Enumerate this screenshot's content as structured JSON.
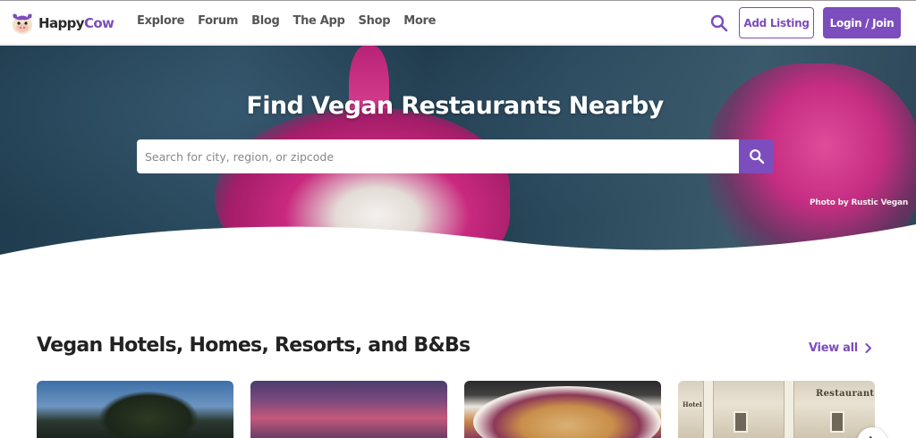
{
  "header": {
    "logo": {
      "happy": "Happy",
      "cow": "Cow"
    },
    "nav": [
      "Explore",
      "Forum",
      "Blog",
      "The App",
      "Shop",
      "More"
    ],
    "add_listing_label": "Add Listing",
    "login_label": "Login / Join"
  },
  "hero": {
    "title": "Find Vegan Restaurants Nearby",
    "search_placeholder": "Search for city, region, or zipcode",
    "photo_credit": "Photo by Rustic Vegan"
  },
  "section": {
    "title": "Vegan Hotels, Homes, Resorts, and B&Bs",
    "view_all_label": "View all",
    "card4_sign": "Restaurant",
    "card4_sign_small": "Hotel"
  },
  "colors": {
    "accent": "#7c4dbd",
    "text": "#222222"
  },
  "icons": {
    "nav_search": "search-icon",
    "hero_search": "search-icon",
    "view_all": "chevron-right-icon",
    "carousel_next": "chevron-right-icon"
  }
}
